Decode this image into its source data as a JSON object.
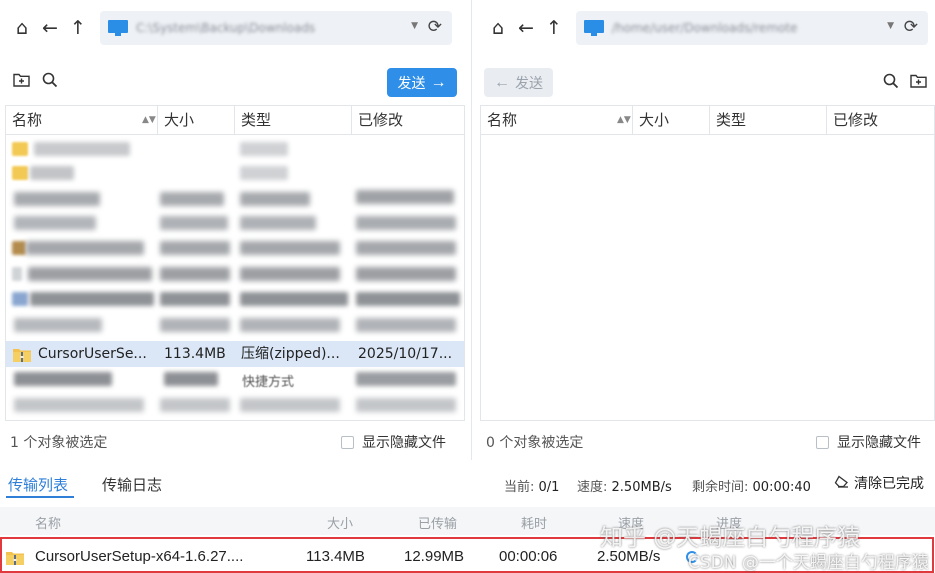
{
  "local_pane": {
    "path_text": "C:\\System\\Backup\\Downloads",
    "send_label": "发送",
    "send_arrow": "→",
    "columns": [
      "名称",
      "大小",
      "类型",
      "已修改"
    ],
    "selected_row": {
      "name": "CursorUserSe...",
      "size": "113.4MB",
      "type": "压缩(zipped)...",
      "modified": "2025/10/17..."
    },
    "partial_row_type": "快捷方式",
    "status": "1 个对象被选定",
    "show_hidden_label": "显示隐藏文件"
  },
  "remote_pane": {
    "path_text": "/home/user/Downloads/remote",
    "send_label": "发送",
    "send_arrow": "←",
    "columns": [
      "名称",
      "大小",
      "类型",
      "已修改"
    ],
    "status": "0 个对象被选定",
    "show_hidden_label": "显示隐藏文件"
  },
  "transfer": {
    "tabs": [
      "传输列表",
      "传输日志"
    ],
    "current_label": "当前:",
    "current_value": "0/1",
    "speed_label": "速度:",
    "speed_value": "2.50MB/s",
    "remaining_label": "剩余时间:",
    "remaining_value": "00:00:40",
    "clear_label": "清除已完成",
    "columns": [
      "名称",
      "大小",
      "已传输",
      "耗时",
      "速度",
      "进度"
    ],
    "row": {
      "name": "CursorUserSetup-x64-1.6.27....",
      "size": "113.4MB",
      "transferred": "12.99MB",
      "elapsed": "00:00:06",
      "speed": "2.50MB/s"
    }
  },
  "watermarks": {
    "zhihu": "知乎 @天蝎座白勺程序猿",
    "csdn": "CSDN @一个天蝎座白勺程序猿"
  },
  "colors": {
    "accent": "#2f8fe8",
    "selection": "#dbe7f7",
    "highlight_border": "#e0393e"
  },
  "icons": [
    "home-icon",
    "back-icon",
    "up-icon",
    "monitor-icon",
    "refresh-icon",
    "new-folder-icon",
    "search-icon",
    "zip-icon",
    "clear-icon"
  ]
}
